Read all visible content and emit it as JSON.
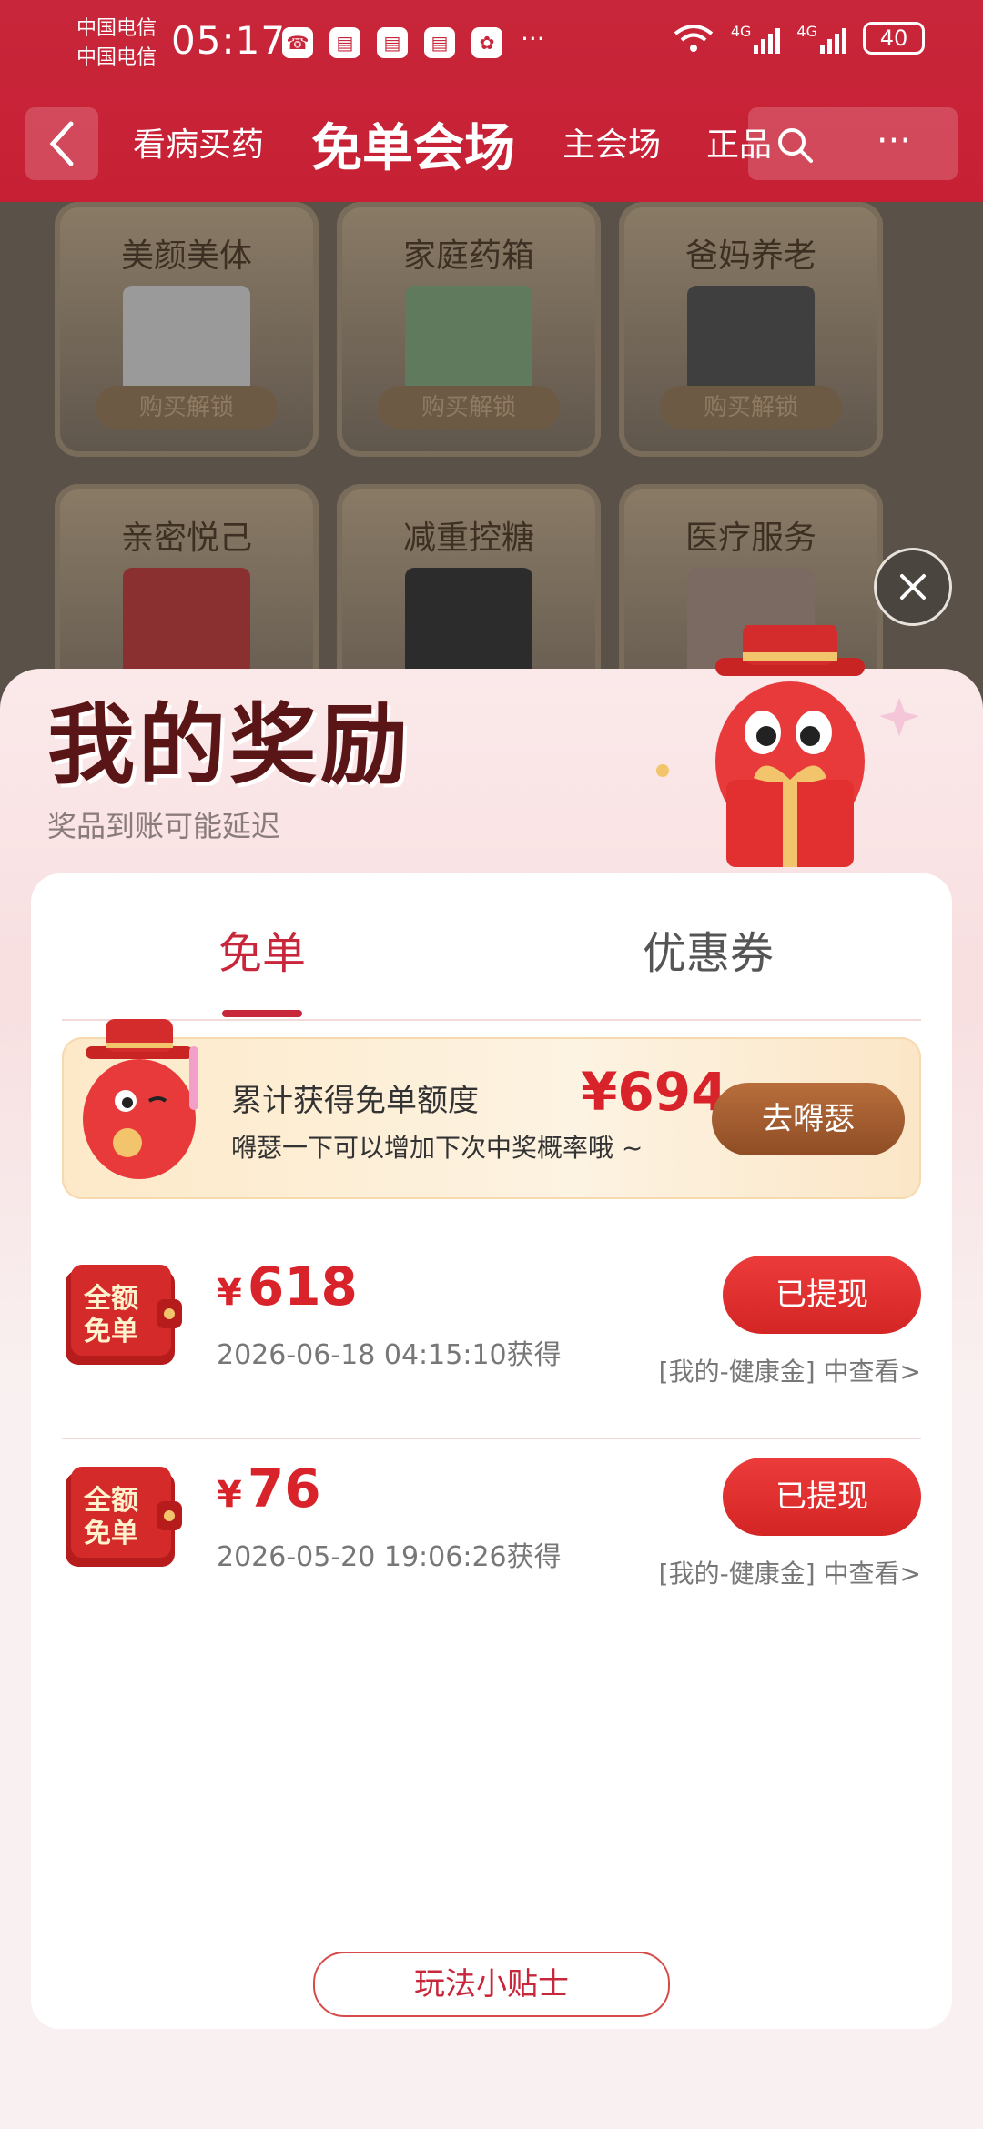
{
  "status_bar": {
    "carrier_1": "中国电信",
    "carrier_2": "中国电信",
    "time": "05:17",
    "battery": "40",
    "network_1": "4G",
    "network_2": "4G"
  },
  "header": {
    "tabs": [
      "看病买药",
      "免单会场",
      "主会场",
      "正品"
    ],
    "active_tab_index": 1
  },
  "background_categories": [
    {
      "title": "美颜美体",
      "action": "购买解锁"
    },
    {
      "title": "家庭药箱",
      "action": "购买解锁"
    },
    {
      "title": "爸妈养老",
      "action": "购买解锁"
    },
    {
      "title": "亲密悦己"
    },
    {
      "title": "减重控糖"
    },
    {
      "title": "医疗服务"
    }
  ],
  "sheet": {
    "title": "我的奖励",
    "subtitle": "奖品到账可能延迟",
    "tabs": [
      "免单",
      "优惠券"
    ],
    "active_tab": "免单",
    "banner": {
      "title": "累计获得免单额度",
      "amount": "¥694",
      "subtitle": "嘚瑟一下可以增加下次中奖概率哦 ~",
      "button": "去嘚瑟"
    },
    "rewards": [
      {
        "badge": "全额免单",
        "currency": "¥",
        "amount": "618",
        "date": "2026-06-18 04:15:10获得",
        "button": "已提现",
        "link": "[我的-健康金] 中查看>"
      },
      {
        "badge": "全额免单",
        "currency": "¥",
        "amount": "76",
        "date": "2026-05-20 19:06:26获得",
        "button": "已提现",
        "link": "[我的-健康金] 中查看>"
      }
    ],
    "tips_button": "玩法小贴士"
  },
  "colors": {
    "brand_red": "#c8263a",
    "amount_red": "#d8232a",
    "banner_button": "#a35a2e"
  }
}
